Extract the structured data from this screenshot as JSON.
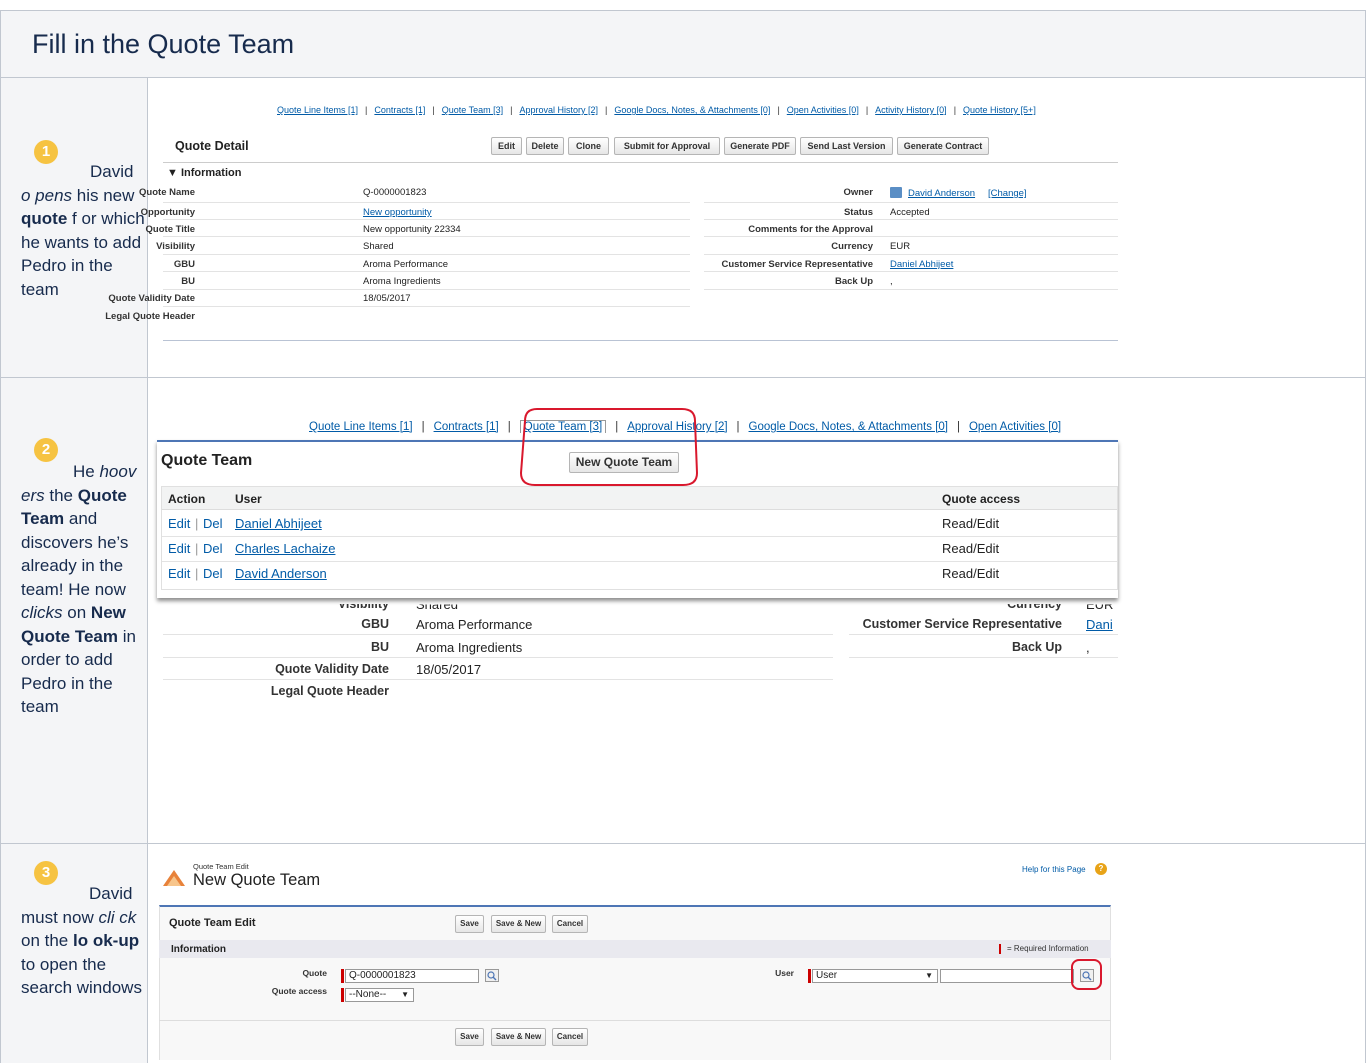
{
  "header": {
    "title": "Fill in the Quote Team"
  },
  "steps": [
    {
      "number": "1",
      "text": {
        "a": "David ",
        "b": "o pens",
        "c": " his new ",
        "d": "quote",
        "e": " f or which he wants to add Pedro in the team"
      }
    },
    {
      "number": "2",
      "text": {
        "a": "He ",
        "b": "hoov ers",
        "c": " the ",
        "d": "Quote Team",
        "e": " and discovers he’s already in the team! He now ",
        "f": "clicks",
        "g": " on ",
        "h": "New Quote Team",
        "i": " in order to add Pedro in the team"
      }
    },
    {
      "number": "3",
      "text": {
        "a": "David must now ",
        "b": "cli ck",
        "c": " on the ",
        "d": "lo ok-up",
        "e": " to open the search windows"
      }
    }
  ],
  "shot1": {
    "related_links": [
      "Quote Line Items [1]",
      "Contracts [1]",
      "Quote Team [3]",
      "Approval History [2]",
      "Google Docs, Notes, & Attachments [0]",
      "Open Activities [0]",
      "Activity History [0]",
      "Quote History [5+]"
    ],
    "section_title": "Quote Detail",
    "buttons": [
      "Edit",
      "Delete",
      "Clone",
      "Submit for Approval",
      "Generate PDF",
      "Send Last Version",
      "Generate Contract"
    ],
    "info_header": "▼ Information",
    "left_fields": [
      {
        "label": "Quote Name",
        "value": "Q-0000001823"
      },
      {
        "label": "Opportunity",
        "value": "New opportunity"
      },
      {
        "label": "Quote Title",
        "value": "New opportunity 22334"
      },
      {
        "label": "Visibility",
        "value": "Shared"
      },
      {
        "label": "GBU",
        "value": "Aroma Performance"
      },
      {
        "label": "BU",
        "value": "Aroma Ingredients"
      },
      {
        "label": "Quote Validity Date",
        "value": "18/05/2017"
      },
      {
        "label": "Legal Quote Header",
        "value": ""
      }
    ],
    "right_fields": [
      {
        "label": "Owner",
        "value": "David Anderson",
        "extra": "[Change]"
      },
      {
        "label": "Status",
        "value": "Accepted"
      },
      {
        "label": "Comments for the Approval",
        "value": ""
      },
      {
        "label": "Currency",
        "value": "EUR"
      },
      {
        "label": "Customer Service Representative",
        "value": "Daniel Abhijeet"
      },
      {
        "label": "Back Up",
        "value": ","
      }
    ]
  },
  "shot2": {
    "related_links": [
      "Quote Line Items [1]",
      "Contracts [1]",
      "Quote Team [3]",
      "Approval History [2]",
      "Google Docs, Notes, & Attachments [0]",
      "Open Activities [0]"
    ],
    "title": "Quote Team",
    "new_button": "New Quote Team",
    "columns": [
      "Action",
      "User",
      "Quote access"
    ],
    "rows": [
      {
        "edit": "Edit",
        "sep": "|",
        "del": "Del",
        "user": "Daniel Abhijeet",
        "access": "Read/Edit"
      },
      {
        "edit": "Edit",
        "sep": "|",
        "del": "Del",
        "user": "Charles Lachaize",
        "access": "Read/Edit"
      },
      {
        "edit": "Edit",
        "sep": "|",
        "del": "Del",
        "user": "David Anderson",
        "access": "Read/Edit"
      }
    ],
    "bg_fields_left": [
      {
        "label": "Visibility",
        "value": "Shared"
      },
      {
        "label": "GBU",
        "value": "Aroma Performance"
      },
      {
        "label": "BU",
        "value": "Aroma Ingredients"
      },
      {
        "label": "Quote Validity Date",
        "value": "18/05/2017"
      },
      {
        "label": "Legal Quote Header",
        "value": ""
      }
    ],
    "bg_fields_right": [
      {
        "label": "Currency",
        "value": "EUR"
      },
      {
        "label": "Customer Service Representative",
        "value": "Dani"
      },
      {
        "label": "Back Up",
        "value": ","
      }
    ]
  },
  "shot3": {
    "small_title": "Quote Team Edit",
    "title": "New Quote Team",
    "help": "Help for this Page",
    "section_title": "Quote Team Edit",
    "buttons": [
      "Save",
      "Save & New",
      "Cancel"
    ],
    "info_label": "Information",
    "required_note": "= Required Information",
    "quote_label": "Quote",
    "quote_value": "Q-0000001823",
    "access_label": "Quote access",
    "access_value": "--None--",
    "user_label": "User",
    "user_type": "User",
    "user_value": ""
  },
  "colors": {
    "badge": "#f6c342",
    "highlight": "#d9182d",
    "link": "#015ba7"
  }
}
